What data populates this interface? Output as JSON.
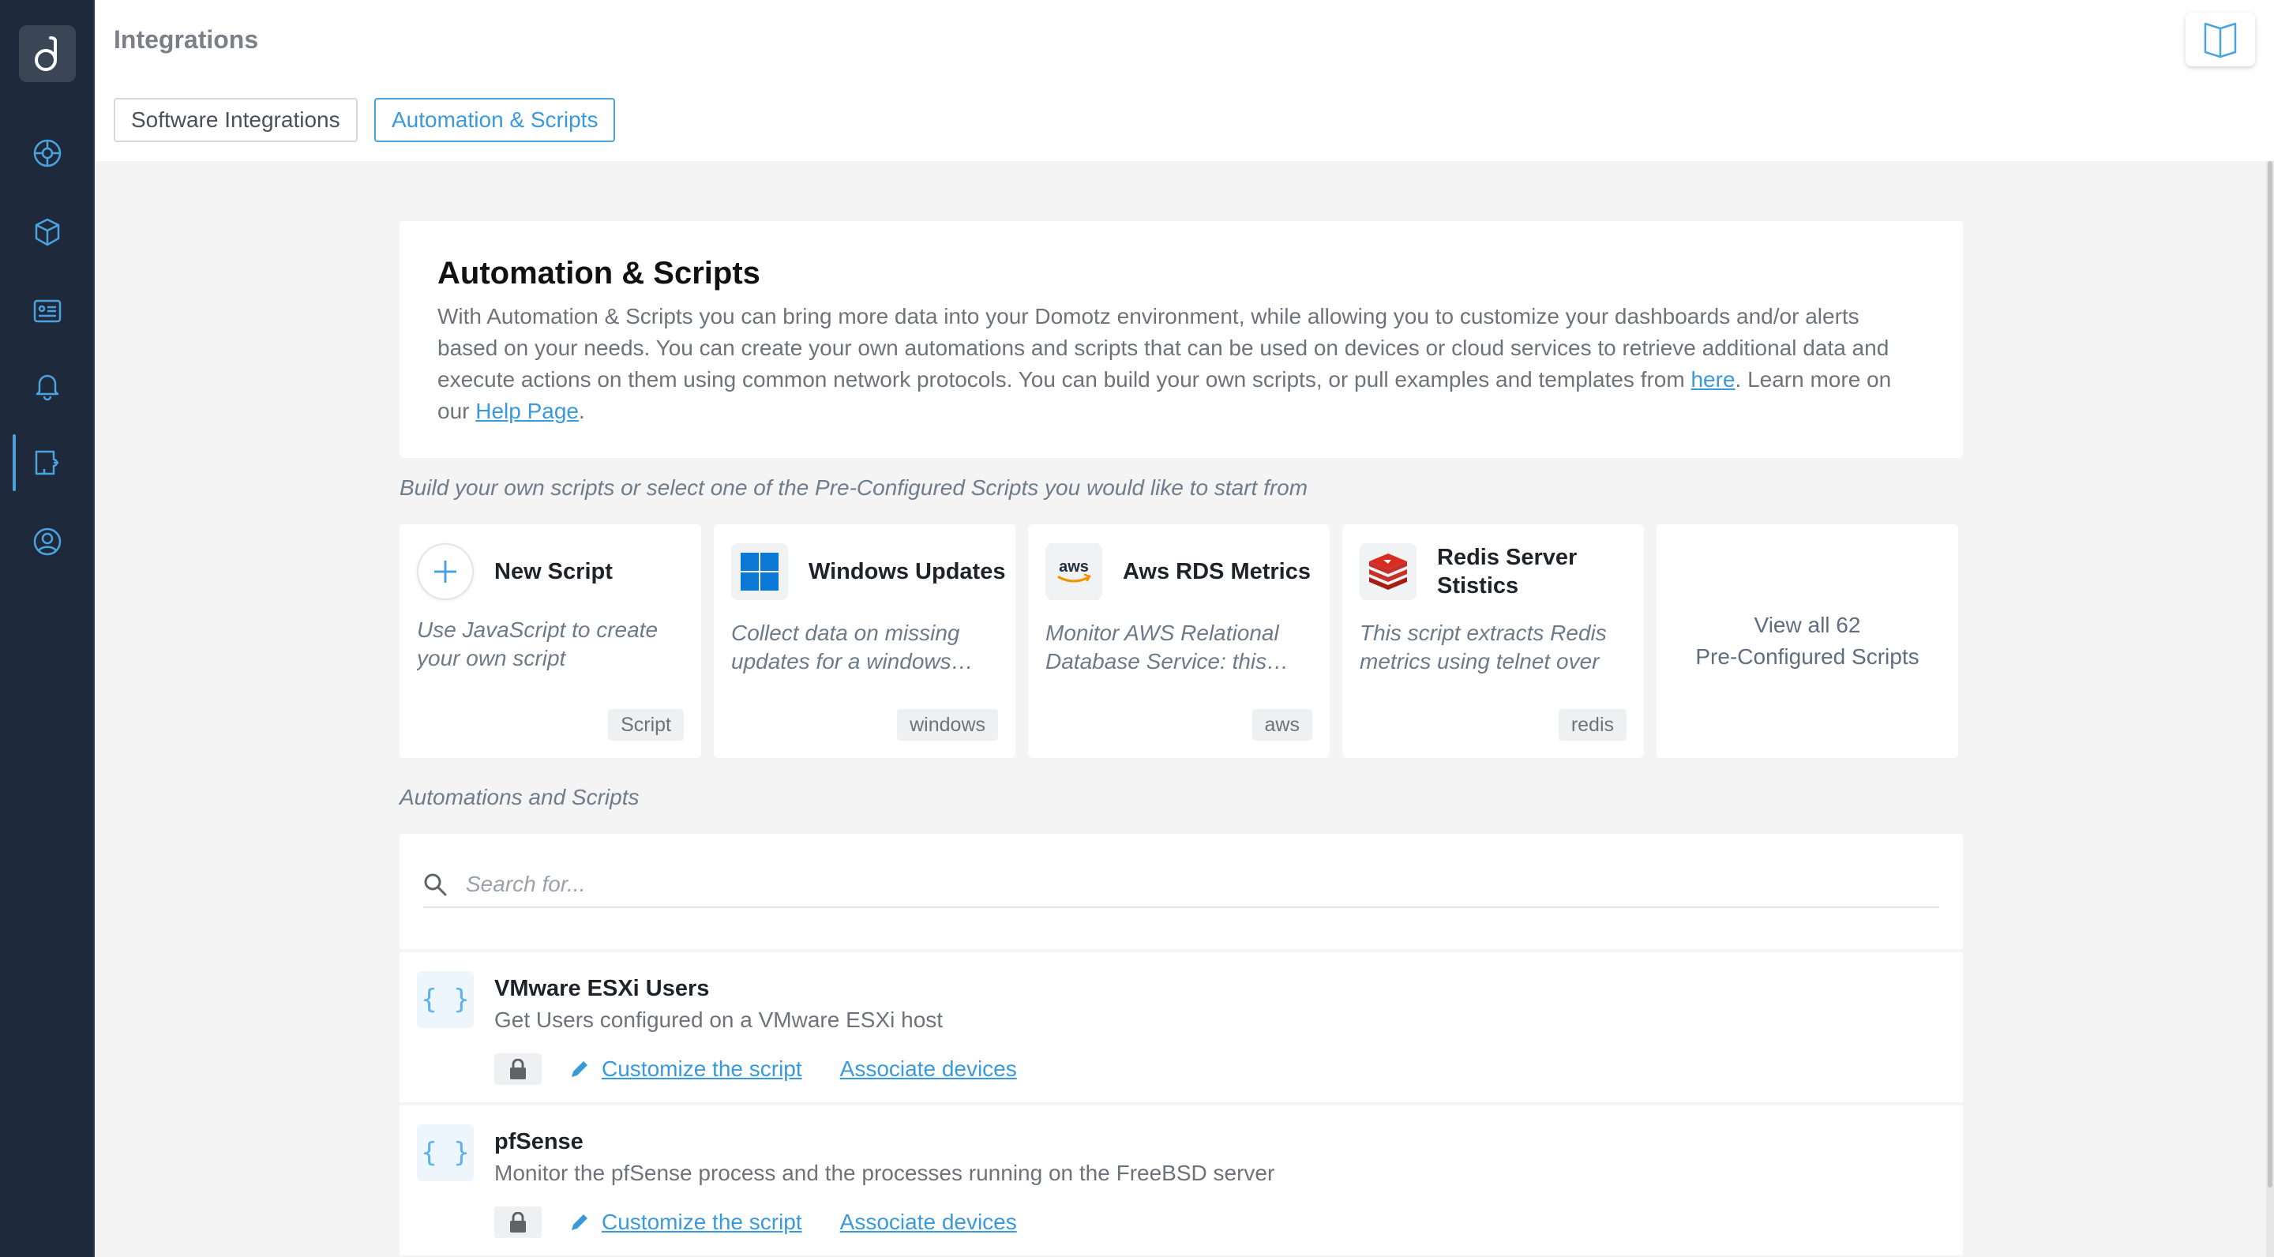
{
  "app": {
    "logo_icon": "domotz-logo-icon",
    "accent_color": "#4aa3df",
    "sidebar_color": "#1e2a3b"
  },
  "sidebar": {
    "items": [
      {
        "icon": "network-globe-icon",
        "active": false
      },
      {
        "icon": "cubes-icon",
        "active": false
      },
      {
        "icon": "dashboard-list-icon",
        "active": false
      },
      {
        "icon": "bell-icon",
        "active": false
      },
      {
        "icon": "puzzle-integration-icon",
        "active": true
      },
      {
        "icon": "user-support-icon",
        "active": false
      }
    ]
  },
  "header": {
    "title": "Integrations",
    "tabs": [
      {
        "label": "Software Integrations",
        "active": false
      },
      {
        "label": "Automation & Scripts",
        "active": true
      }
    ],
    "help_icon": "book-icon"
  },
  "intro": {
    "title": "Automation & Scripts",
    "text_before_link": "With Automation & Scripts you can bring more data into your Domotz environment, while allowing you to customize your dashboards and/or alerts based on your needs. You can create your own automations and scripts that can be used on devices or cloud services to retrieve additional data and execute actions on them using common network protocols. You can build your own scripts, or pull examples and templates from ",
    "link_here": "here",
    "text_middle": ". Learn more on our ",
    "link_help": "Help Page",
    "text_end": "."
  },
  "preconfigured": {
    "caption": "Build your own scripts or select one of the Pre-Configured Scripts you would like to start from",
    "cards": [
      {
        "name": "New Script",
        "icon": "plus-icon",
        "description": "Use JavaScript to create your own script",
        "tag": "Script"
      },
      {
        "name": "Windows Updates",
        "icon": "windows-logo-icon",
        "description": "Collect data on missing updates for a windows machine",
        "tag": "windows"
      },
      {
        "name": "Aws RDS Metrics",
        "icon": "aws-logo-icon",
        "description": "Monitor AWS Relational Database Service: this script",
        "tag": "aws"
      },
      {
        "name": "Redis Server Stistics",
        "icon": "redis-logo-icon",
        "description": "This script extracts Redis metrics using telnet over",
        "tag": "redis"
      }
    ],
    "view_all_line1": "View all 62",
    "view_all_line2": "Pre-Configured Scripts"
  },
  "automations": {
    "caption": "Automations and Scripts",
    "search_placeholder": "Search for...",
    "rows": [
      {
        "title": "VMware ESXi Users",
        "description": "Get Users configured on a VMware ESXi host",
        "icon_text": "{ }",
        "customize_label": "Customize the script",
        "associate_label": "Associate devices"
      },
      {
        "title": "pfSense",
        "description": "Monitor the pfSense process and the processes running on the FreeBSD server",
        "icon_text": "{ }",
        "customize_label": "Customize the script",
        "associate_label": "Associate devices"
      }
    ]
  }
}
